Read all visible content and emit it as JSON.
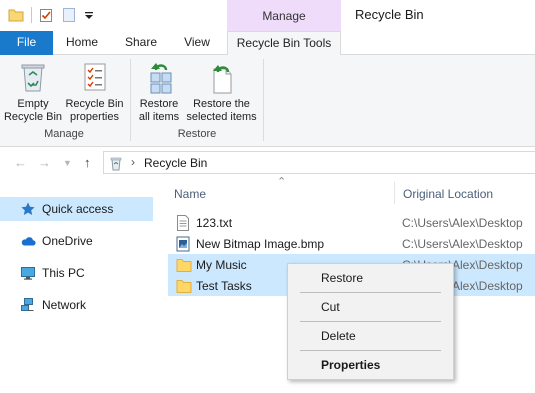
{
  "window": {
    "title": "Recycle Bin",
    "contextual_tab_group": "Manage"
  },
  "ribbon": {
    "tabs": [
      {
        "label": "File"
      },
      {
        "label": "Home"
      },
      {
        "label": "Share"
      },
      {
        "label": "View"
      },
      {
        "label": "Recycle Bin Tools"
      }
    ],
    "groups": [
      {
        "label": "Manage",
        "buttons": [
          {
            "label": "Empty Recycle Bin",
            "icon": "recycle-bin-icon"
          },
          {
            "label": "Recycle Bin properties",
            "icon": "properties-icon"
          }
        ]
      },
      {
        "label": "Restore",
        "buttons": [
          {
            "label": "Restore all items",
            "icon": "restore-all-icon"
          },
          {
            "label": "Restore the selected items",
            "icon": "restore-selected-icon"
          }
        ]
      }
    ]
  },
  "address": {
    "path": "Recycle Bin",
    "separator": "›"
  },
  "nav_pane": {
    "items": [
      {
        "label": "Quick access",
        "icon": "star-icon",
        "selected": true
      },
      {
        "label": "OneDrive",
        "icon": "cloud-icon",
        "selected": false
      },
      {
        "label": "This PC",
        "icon": "computer-icon",
        "selected": false
      },
      {
        "label": "Network",
        "icon": "network-icon",
        "selected": false
      }
    ]
  },
  "file_list": {
    "columns": [
      "Name",
      "Original Location"
    ],
    "rows": [
      {
        "name": "123.txt",
        "location": "C:\\Users\\Alex\\Desktop",
        "icon": "text-file-icon",
        "selected": false
      },
      {
        "name": "New Bitmap Image.bmp",
        "location": "C:\\Users\\Alex\\Desktop",
        "icon": "image-file-icon",
        "selected": false
      },
      {
        "name": "My Music",
        "location": "C:\\Users\\Alex\\Desktop",
        "icon": "folder-icon",
        "selected": true
      },
      {
        "name": "Test Tasks",
        "location": "C:\\Users\\Alex\\Desktop",
        "icon": "folder-icon",
        "selected": true
      }
    ]
  },
  "context_menu": {
    "items": [
      "Restore",
      "Cut",
      "Delete",
      "Properties"
    ]
  },
  "colors": {
    "file_tab": "#1979ca",
    "selection": "#cce8ff",
    "manage_band": "#eedcfa",
    "ribbon_bg": "#f5f6f7",
    "folder": "#ffd766"
  }
}
